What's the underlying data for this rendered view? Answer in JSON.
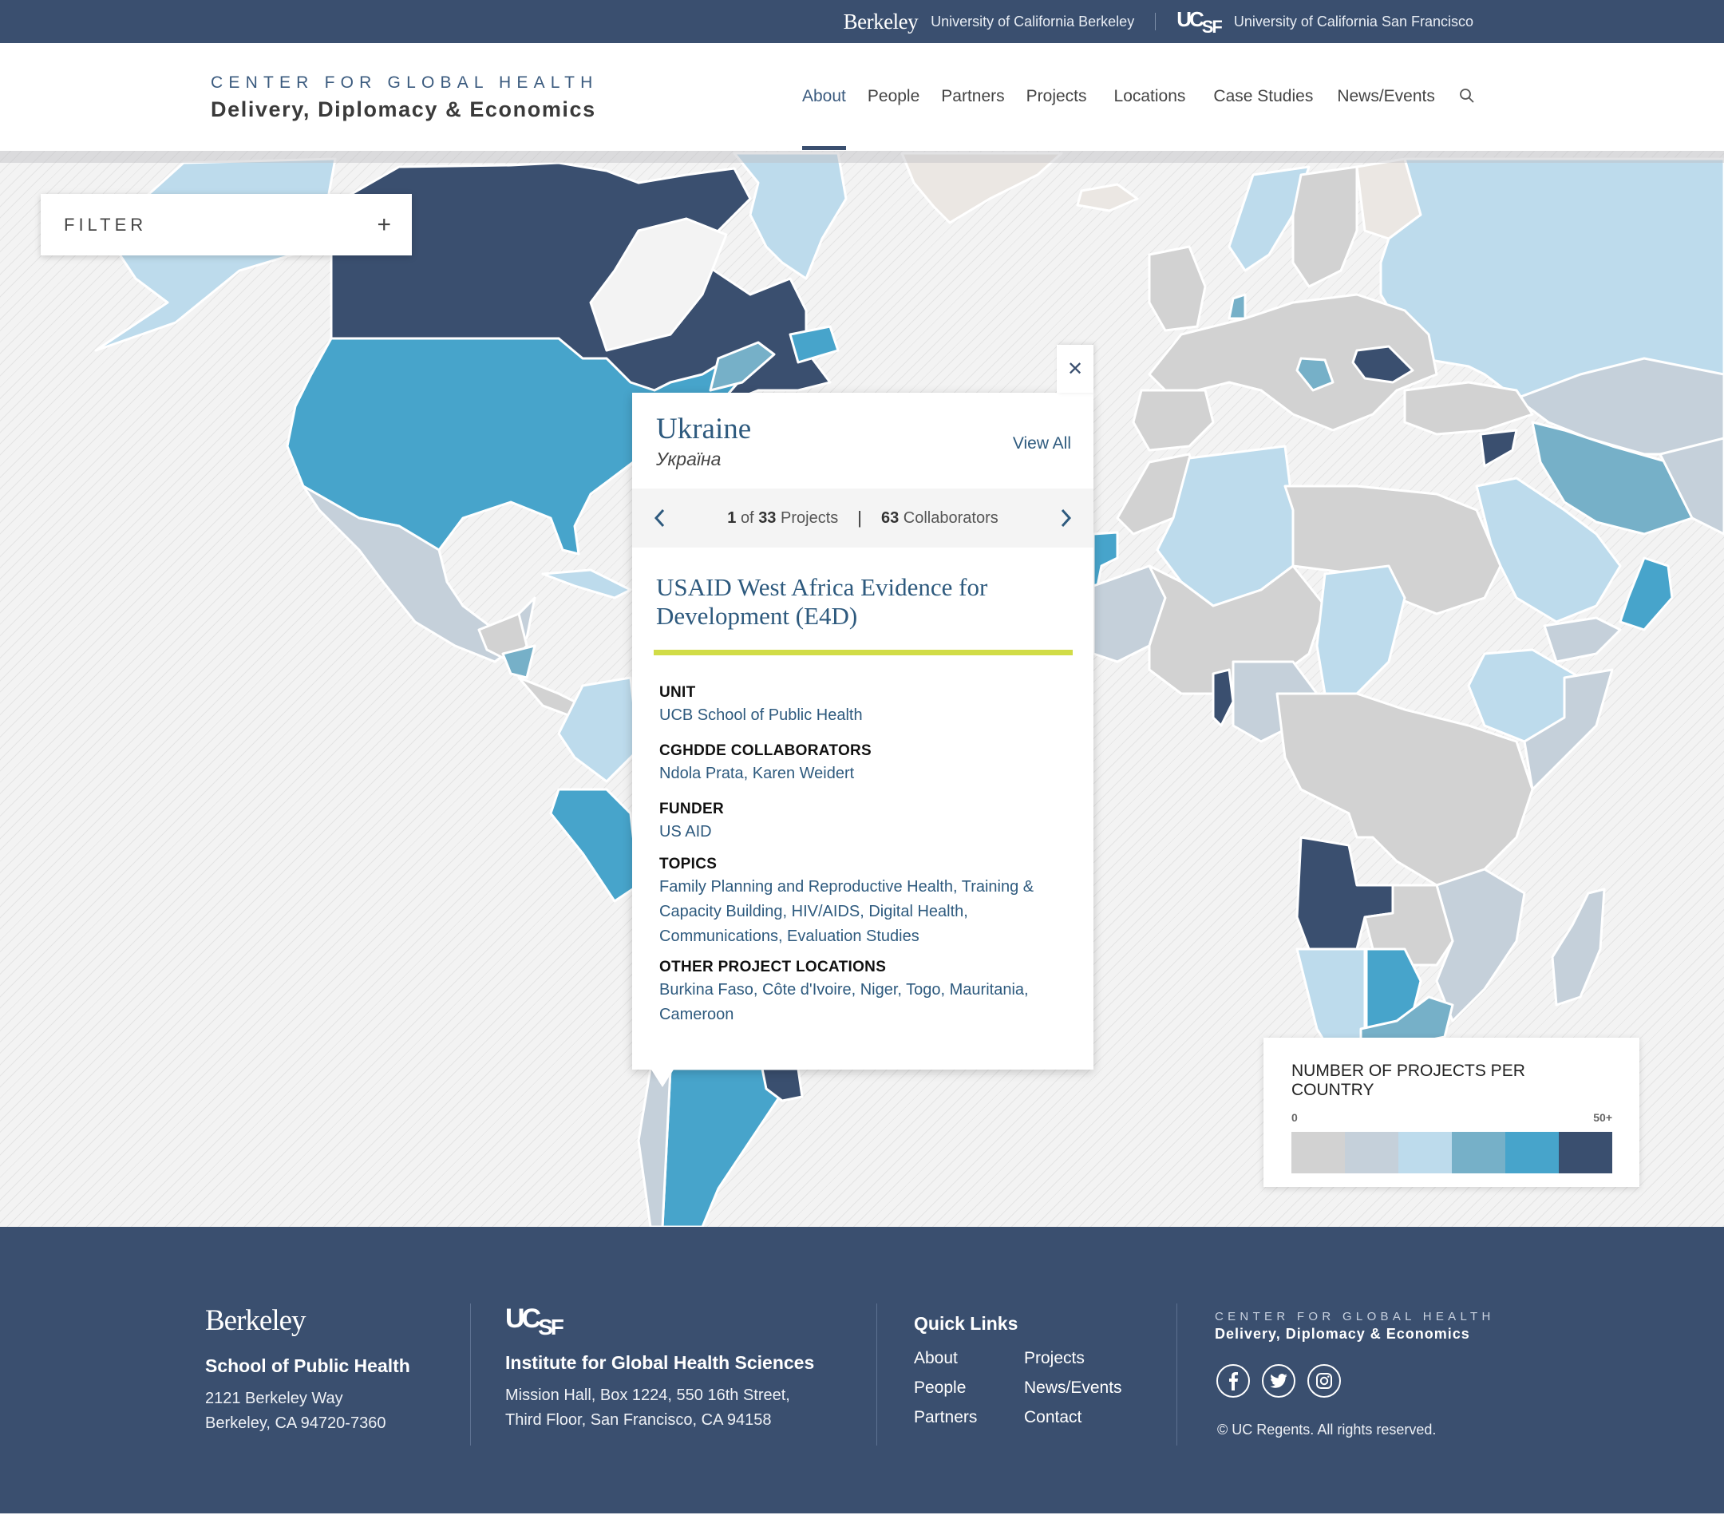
{
  "topbar": {
    "berkeley_logo": "Berkeley",
    "berkeley_name": "University of California Berkeley",
    "ucsf_logo_uc": "UC",
    "ucsf_logo_sf": "SF",
    "ucsf_name": "University of California San Francisco"
  },
  "header": {
    "brand_line1": "CENTER FOR GLOBAL HEALTH",
    "brand_line2": "Delivery, Diplomacy & Economics",
    "nav": [
      {
        "label": "About",
        "active": true
      },
      {
        "label": "People"
      },
      {
        "label": "Partners"
      },
      {
        "label": "Projects"
      },
      {
        "label": "Locations"
      },
      {
        "label": "Case Studies"
      },
      {
        "label": "News/Events"
      }
    ],
    "search_icon": "search-icon"
  },
  "filter": {
    "label": "FILTER",
    "toggle_icon": "plus-icon"
  },
  "popup": {
    "close_icon": "close-icon",
    "country": "Ukraine",
    "country_native": "Україна",
    "view_all": "View All",
    "pager": {
      "current": "1",
      "of": "of",
      "total": "33",
      "projects_label": "Projects",
      "collaborators_count": "63",
      "collaborators_label": "Collaborators"
    },
    "project_title": "USAID West Africa Evidence for Development (E4D)",
    "accent_color": "#d1dc47",
    "fields": [
      {
        "label": "UNIT",
        "value": "UCB School of Public Health"
      },
      {
        "label": "CGHDDE COLLABORATORS",
        "value": "Ndola Prata, Karen Weidert"
      },
      {
        "label": "FUNDER",
        "value": "US AID"
      },
      {
        "label": "TOPICS",
        "value": "Family Planning and Reproductive Health, Training & Capacity Building, HIV/AIDS, Digital Health, Communications, Evaluation Studies"
      },
      {
        "label": "OTHER PROJECT LOCATIONS",
        "value": "Burkina Faso, Côte d'Ivoire, Niger, Togo, Mauritania, Cameroon"
      }
    ]
  },
  "legend": {
    "title": "NUMBER OF PROJECTS PER COUNTRY",
    "min_label": "0",
    "max_label": "50+",
    "colors": [
      "#d2d2d2",
      "#c5d0da",
      "#bddbec",
      "#76b0c8",
      "#47a4cb",
      "#3a4f6f"
    ]
  },
  "map": {
    "no_data_color": "#ebe7e3",
    "highlighted_countries": [
      {
        "name": "Canada",
        "bin": 5
      },
      {
        "name": "United States",
        "bin": 4
      },
      {
        "name": "Mexico",
        "bin": 1
      },
      {
        "name": "Alaska",
        "bin": 2
      },
      {
        "name": "Russia",
        "bin": 2
      },
      {
        "name": "Romania",
        "bin": 5
      },
      {
        "name": "Syria",
        "bin": 5
      },
      {
        "name": "Iran",
        "bin": 3
      },
      {
        "name": "Oman",
        "bin": 4
      },
      {
        "name": "Algeria",
        "bin": 2
      },
      {
        "name": "Mauritania",
        "bin": 4
      },
      {
        "name": "Benin",
        "bin": 5
      },
      {
        "name": "Angola",
        "bin": 5
      },
      {
        "name": "Botswana",
        "bin": 4
      },
      {
        "name": "South Africa",
        "bin": 3
      },
      {
        "name": "Namibia",
        "bin": 2
      },
      {
        "name": "Ethiopia",
        "bin": 2
      },
      {
        "name": "Saudi Arabia",
        "bin": 2
      },
      {
        "name": "Peru",
        "bin": 4
      },
      {
        "name": "Argentina",
        "bin": 4
      },
      {
        "name": "Uruguay",
        "bin": 5
      },
      {
        "name": "Chile",
        "bin": 1
      },
      {
        "name": "Greenland",
        "bin": 2
      }
    ]
  },
  "footer": {
    "col1": {
      "logo": "Berkeley",
      "heading": "School of Public Health",
      "address_line1": "2121 Berkeley Way",
      "address_line2": "Berkeley, CA 94720-7360"
    },
    "col2": {
      "logo_uc": "UC",
      "logo_sf": "SF",
      "heading": "Institute for Global Health Sciences",
      "address_line1": "Mission Hall, Box 1224, 550 16th Street,",
      "address_line2": "Third Floor, San Francisco, CA 94158"
    },
    "quick_links": {
      "heading": "Quick Links",
      "links": [
        "About",
        "Projects",
        "People",
        "News/Events",
        "Partners",
        "Contact"
      ]
    },
    "brand": {
      "line1": "CENTER FOR GLOBAL HEALTH",
      "line2": "Delivery, Diplomacy & Economics"
    },
    "social": [
      "facebook-icon",
      "twitter-icon",
      "instagram-icon"
    ],
    "copyright": "© UC Regents. All rights reserved."
  }
}
